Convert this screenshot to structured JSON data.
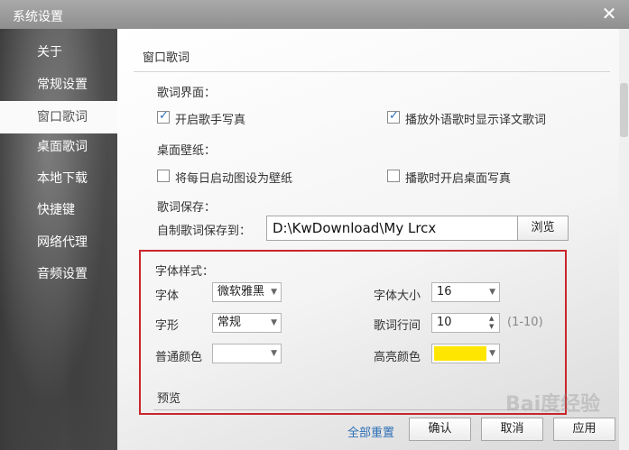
{
  "window": {
    "title": "系统设置",
    "close_glyph": "✕"
  },
  "sidebar": {
    "items": [
      {
        "label": "关于",
        "active": false
      },
      {
        "label": "常规设置",
        "active": false
      },
      {
        "label": "窗口歌词",
        "active": true
      },
      {
        "label": "桌面歌词",
        "active": false
      },
      {
        "label": "本地下载",
        "active": false
      },
      {
        "label": "快捷键",
        "active": false
      },
      {
        "label": "网络代理",
        "active": false
      },
      {
        "label": "音频设置",
        "active": false
      }
    ]
  },
  "panel": {
    "title": "窗口歌词",
    "lyrics_ui": {
      "heading": "歌词界面：",
      "show_singer_photo": {
        "label": "开启歌手写真",
        "checked": true
      },
      "show_translation": {
        "label": "播放外语歌时显示译文歌词",
        "checked": true
      }
    },
    "wallpaper": {
      "heading": "桌面壁纸：",
      "daily_wallpaper": {
        "label": "将每日启动图设为壁纸",
        "checked": false
      },
      "desktop_photo": {
        "label": "播歌时开启桌面写真",
        "checked": false
      }
    },
    "save": {
      "heading": "歌词保存：",
      "path_label": "自制歌词保存到：",
      "path_value": "D:\\KwDownload\\My Lrcx",
      "browse_label": "浏览"
    },
    "font_style": {
      "heading": "字体样式：",
      "font_label": "字体",
      "font_value": "微软雅黑",
      "size_label": "字体大小",
      "size_value": "16",
      "shape_label": "字形",
      "shape_value": "常规",
      "line_spacing_label": "歌词行间",
      "line_spacing_value": "10",
      "line_spacing_range": "(1-10)",
      "normal_color_label": "普通颜色",
      "normal_color": "#ffffff",
      "highlight_color_label": "高亮颜色",
      "highlight_color": "#ffe600",
      "preview_label": "预览"
    }
  },
  "footer": {
    "reset_label": "全部重置",
    "ok_label": "确认",
    "cancel_label": "取消",
    "apply_label": "应用"
  },
  "watermark": "Bai度经验",
  "colors": {
    "accent_blue": "#2d6fb6",
    "highlight_border": "#c9262b",
    "checkbox_check": "#2a6db5"
  },
  "icons": {
    "close": "close-icon",
    "check": "check-icon",
    "dropdown": "chevron-down-icon",
    "spinner": "spinner-arrows-icon"
  }
}
